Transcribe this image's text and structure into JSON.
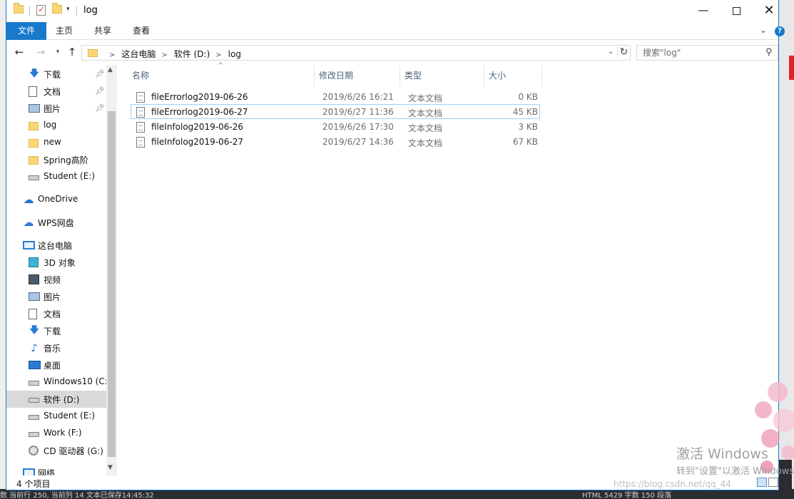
{
  "window": {
    "title": "log",
    "controls": {
      "minimize": "—",
      "maximize": "",
      "close": "✕"
    }
  },
  "ribbon": {
    "tabs": [
      "文件",
      "主页",
      "共享",
      "查看"
    ],
    "help": "?"
  },
  "address": {
    "crumbs": [
      "这台电脑",
      "软件 (D:)",
      "log"
    ]
  },
  "search": {
    "placeholder": "搜索\"log\""
  },
  "nav": {
    "quick_access": [
      {
        "label": "下载",
        "icon": "download-icon",
        "pinned": true
      },
      {
        "label": "文档",
        "icon": "document-icon",
        "pinned": true
      },
      {
        "label": "图片",
        "icon": "picture-icon",
        "pinned": true
      },
      {
        "label": "log",
        "icon": "folder-icon"
      },
      {
        "label": "new",
        "icon": "folder-icon"
      },
      {
        "label": "Spring高阶",
        "icon": "folder-icon"
      },
      {
        "label": "Student (E:)",
        "icon": "drive-icon"
      }
    ],
    "onedrive": "OneDrive",
    "wps": "WPS网盘",
    "this_pc": "这台电脑",
    "pc_items": [
      {
        "label": "3D 对象",
        "icon": "3d-objects-icon"
      },
      {
        "label": "视频",
        "icon": "video-icon"
      },
      {
        "label": "图片",
        "icon": "picture-icon"
      },
      {
        "label": "文档",
        "icon": "document-icon"
      },
      {
        "label": "下载",
        "icon": "download-icon"
      },
      {
        "label": "音乐",
        "icon": "music-icon"
      },
      {
        "label": "桌面",
        "icon": "desktop-icon"
      },
      {
        "label": "Windows10 (C:",
        "icon": "windows-drive-icon"
      },
      {
        "label": "软件 (D:)",
        "icon": "drive-icon",
        "selected": true
      },
      {
        "label": "Student (E:)",
        "icon": "drive-icon"
      },
      {
        "label": "Work (F:)",
        "icon": "drive-icon"
      },
      {
        "label": "CD 驱动器 (G:)",
        "icon": "cd-drive-icon"
      }
    ],
    "network": "网络"
  },
  "columns": {
    "name": "名称",
    "date": "修改日期",
    "type": "类型",
    "size": "大小"
  },
  "files": [
    {
      "name": "fileErrorlog2019-06-26",
      "date": "2019/6/26 16:21",
      "type": "文本文档",
      "size": "0 KB"
    },
    {
      "name": "fileErrorlog2019-06-27",
      "date": "2019/6/27 11:36",
      "type": "文本文档",
      "size": "45 KB",
      "focused": true
    },
    {
      "name": "fileInfolog2019-06-26",
      "date": "2019/6/26 17:30",
      "type": "文本文档",
      "size": "3 KB"
    },
    {
      "name": "fileInfolog2019-06-27",
      "date": "2019/6/27 14:36",
      "type": "文本文档",
      "size": "67 KB"
    }
  ],
  "status": {
    "count": "4 个项目"
  },
  "watermark": {
    "activate_title": "激活 Windows",
    "activate_sub": "转到\"设置\"以激活 Windows",
    "csdn": "https://blog.csdn.net/qq_44"
  },
  "background": {
    "bottom_strip": [
      "数 当前行 250, 当前列 14 文本已保存14:45:32",
      "HTML 5429 字数 150 段落"
    ]
  },
  "colors": {
    "accent": "#1979ca",
    "selected_nav": "#d9d9d9",
    "focus_border": "#99d1ff",
    "folder": "#f8d774"
  }
}
